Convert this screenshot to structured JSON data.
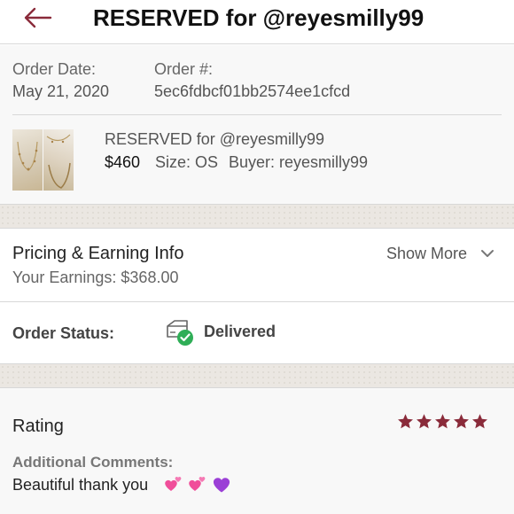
{
  "header": {
    "title": "RESERVED for @reyesmilly99",
    "back_icon": "arrow-left-icon"
  },
  "order": {
    "date_label": "Order Date:",
    "date_value": "May 21, 2020",
    "number_label": "Order #:",
    "number_value": "5ec6fdbcf01bb2574ee1cfcd"
  },
  "item": {
    "title": "RESERVED for @reyesmilly99",
    "price": "$460",
    "size": "Size: OS",
    "buyer": "Buyer: reyesmilly99"
  },
  "pricing": {
    "title": "Pricing & Earning Info",
    "earnings": "Your Earnings: $368.00",
    "show_more": "Show More"
  },
  "status": {
    "label": "Order Status:",
    "value": "Delivered",
    "icon": "box-check-icon"
  },
  "rating": {
    "title": "Rating",
    "stars": 5,
    "max_stars": 5,
    "comments_label": "Additional Comments:",
    "comments_text": "Beautiful thank you",
    "emojis": [
      "two-hearts",
      "two-hearts",
      "purple-heart"
    ]
  },
  "colors": {
    "accent": "#8a2b3a",
    "check_green": "#2fae57",
    "band": "#ebe7e2"
  }
}
